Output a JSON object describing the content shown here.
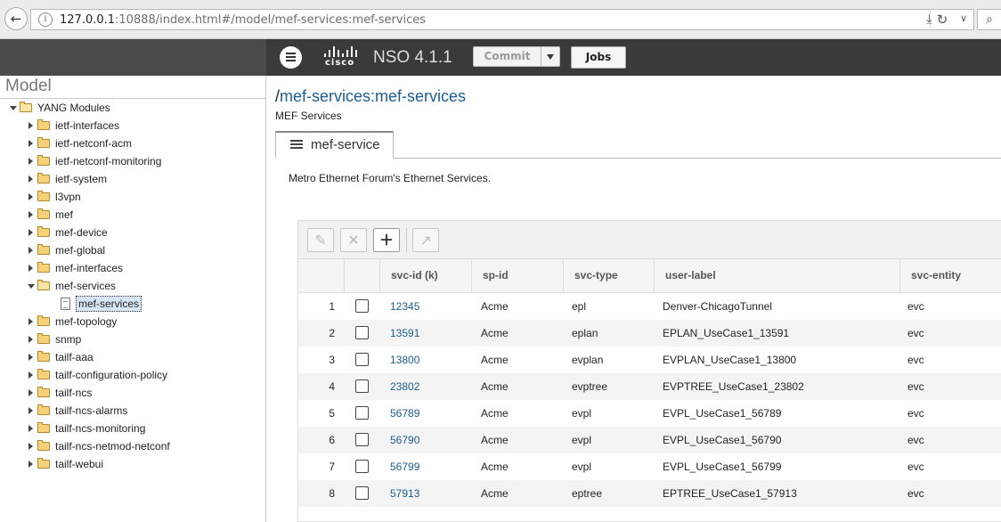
{
  "browser": {
    "url_host": "127.0.0.1",
    "url_rest": ":10888/index.html#/model/mef-services:mef-services"
  },
  "header": {
    "brand": "cisco",
    "title": "NSO 4.1.1",
    "commit_label": "Commit",
    "jobs_label": "Jobs"
  },
  "sidebar": {
    "title": "Model",
    "root": "YANG Modules",
    "items": [
      {
        "label": "ietf-interfaces"
      },
      {
        "label": "ietf-netconf-acm"
      },
      {
        "label": "ietf-netconf-monitoring"
      },
      {
        "label": "ietf-system"
      },
      {
        "label": "l3vpn"
      },
      {
        "label": "mef"
      },
      {
        "label": "mef-device"
      },
      {
        "label": "mef-global"
      },
      {
        "label": "mef-interfaces"
      },
      {
        "label": "mef-services"
      },
      {
        "label": "mef-topology"
      },
      {
        "label": "snmp"
      },
      {
        "label": "tailf-aaa"
      },
      {
        "label": "tailf-configuration-policy"
      },
      {
        "label": "tailf-ncs"
      },
      {
        "label": "tailf-ncs-alarms"
      },
      {
        "label": "tailf-ncs-monitoring"
      },
      {
        "label": "tailf-ncs-netmod-netconf"
      },
      {
        "label": "tailf-webui"
      }
    ],
    "selected_child": "mef-services"
  },
  "main": {
    "path": "mef-services:mef-services",
    "subtitle": "MEF Services",
    "tab_label": "mef-service",
    "description": "Metro Ethernet Forum's Ethernet Services."
  },
  "table": {
    "columns": [
      "svc-id  (k)",
      "sp-id",
      "svc-type",
      "user-label",
      "svc-entity"
    ],
    "rows": [
      {
        "n": "1",
        "svc_id": "12345",
        "sp_id": "Acme",
        "svc_type": "epl",
        "user_label": "Denver-ChicagoTunnel",
        "svc_entity": "evc"
      },
      {
        "n": "2",
        "svc_id": "13591",
        "sp_id": "Acme",
        "svc_type": "eplan",
        "user_label": "EPLAN_UseCase1_13591",
        "svc_entity": "evc"
      },
      {
        "n": "3",
        "svc_id": "13800",
        "sp_id": "Acme",
        "svc_type": "evplan",
        "user_label": "EVPLAN_UseCase1_13800",
        "svc_entity": "evc"
      },
      {
        "n": "4",
        "svc_id": "23802",
        "sp_id": "Acme",
        "svc_type": "evptree",
        "user_label": "EVPTREE_UseCase1_23802",
        "svc_entity": "evc"
      },
      {
        "n": "5",
        "svc_id": "56789",
        "sp_id": "Acme",
        "svc_type": "evpl",
        "user_label": "EVPL_UseCase1_56789",
        "svc_entity": "evc"
      },
      {
        "n": "6",
        "svc_id": "56790",
        "sp_id": "Acme",
        "svc_type": "evpl",
        "user_label": "EVPL_UseCase1_56790",
        "svc_entity": "evc"
      },
      {
        "n": "7",
        "svc_id": "56799",
        "sp_id": "Acme",
        "svc_type": "evpl",
        "user_label": "EVPL_UseCase1_56799",
        "svc_entity": "evc"
      },
      {
        "n": "8",
        "svc_id": "57913",
        "sp_id": "Acme",
        "svc_type": "eptree",
        "user_label": "EPTREE_UseCase1_57913",
        "svc_entity": "evc"
      }
    ]
  }
}
